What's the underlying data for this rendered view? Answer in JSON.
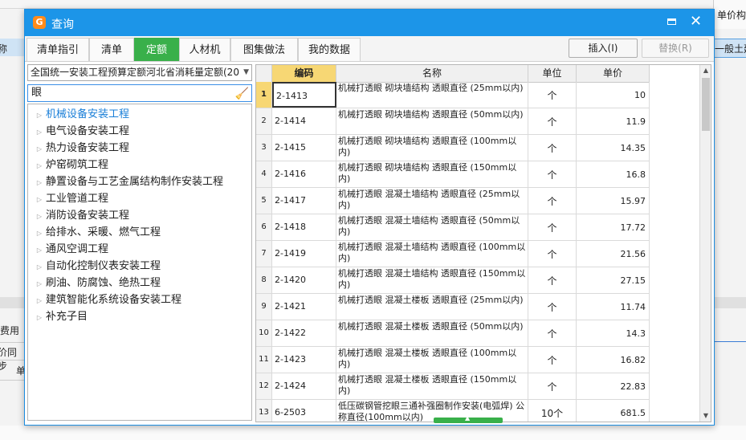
{
  "background": {
    "right_header": "单价构",
    "left_row_text": "称",
    "right_row_text": "一般土建",
    "fee_label": "费用",
    "sync_label": "价同步",
    "unit_label": "单"
  },
  "dialog": {
    "title": "查询",
    "tabs": [
      "清单指引",
      "清单",
      "定额",
      "人材机",
      "图集做法",
      "我的数据"
    ],
    "active_tab": "定额",
    "insert_button": "插入(I)",
    "replace_button": "替换(R)"
  },
  "library_select": {
    "value": "全国统一安装工程预算定额河北省消耗量定额(20"
  },
  "search": {
    "value": "眼"
  },
  "tree": {
    "items": [
      "机械设备安装工程",
      "电气设备安装工程",
      "热力设备安装工程",
      "炉窑砌筑工程",
      "静置设备与工艺金属结构制作安装工程",
      "工业管道工程",
      "消防设备安装工程",
      "给排水、采暖、燃气工程",
      "通风空调工程",
      "自动化控制仪表安装工程",
      "刷油、防腐蚀、绝热工程",
      "建筑智能化系统设备安装工程",
      "补充子目"
    ],
    "selected_index": 0
  },
  "grid": {
    "columns": [
      "编码",
      "名称",
      "单位",
      "单价"
    ],
    "rows": [
      {
        "idx": "1",
        "code": "2-1413",
        "name": "机械打透眼 砌块墙结构 透眼直径 (25mm以内)",
        "unit": "个",
        "price": "10"
      },
      {
        "idx": "2",
        "code": "2-1414",
        "name": "机械打透眼 砌块墙结构 透眼直径 (50mm以内)",
        "unit": "个",
        "price": "11.9"
      },
      {
        "idx": "3",
        "code": "2-1415",
        "name": "机械打透眼 砌块墙结构 透眼直径 (100mm以内)",
        "unit": "个",
        "price": "14.35"
      },
      {
        "idx": "4",
        "code": "2-1416",
        "name": "机械打透眼 砌块墙结构 透眼直径 (150mm以内)",
        "unit": "个",
        "price": "16.8"
      },
      {
        "idx": "5",
        "code": "2-1417",
        "name": "机械打透眼 混凝土墙结构 透眼直径 (25mm以内)",
        "unit": "个",
        "price": "15.97"
      },
      {
        "idx": "6",
        "code": "2-1418",
        "name": "机械打透眼 混凝土墙结构 透眼直径 (50mm以内)",
        "unit": "个",
        "price": "17.72"
      },
      {
        "idx": "7",
        "code": "2-1419",
        "name": "机械打透眼 混凝土墙结构 透眼直径 (100mm以内)",
        "unit": "个",
        "price": "21.56"
      },
      {
        "idx": "8",
        "code": "2-1420",
        "name": "机械打透眼 混凝土墙结构 透眼直径 (150mm以内)",
        "unit": "个",
        "price": "27.15"
      },
      {
        "idx": "9",
        "code": "2-1421",
        "name": "机械打透眼 混凝土楼板 透眼直径 (25mm以内)",
        "unit": "个",
        "price": "11.74"
      },
      {
        "idx": "10",
        "code": "2-1422",
        "name": "机械打透眼 混凝土楼板 透眼直径 (50mm以内)",
        "unit": "个",
        "price": "14.3"
      },
      {
        "idx": "11",
        "code": "2-1423",
        "name": "机械打透眼 混凝土楼板 透眼直径 (100mm以内)",
        "unit": "个",
        "price": "16.82"
      },
      {
        "idx": "12",
        "code": "2-1424",
        "name": "机械打透眼 混凝土楼板 透眼直径 (150mm以内)",
        "unit": "个",
        "price": "22.83"
      },
      {
        "idx": "13",
        "code": "6-2503",
        "name": "低压碳钢管挖眼三通补强圈制作安装(电弧焊) 公称直径(100mm以内)",
        "unit": "10个",
        "price": "681.5"
      }
    ],
    "selected_row": 0
  }
}
